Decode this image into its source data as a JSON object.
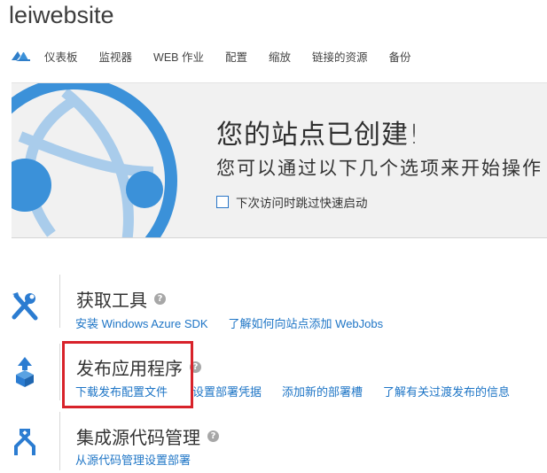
{
  "site": {
    "title": "leiwebsite"
  },
  "nav": {
    "tabs": [
      {
        "label": "仪表板"
      },
      {
        "label": "监视器"
      },
      {
        "label": "WEB 作业"
      },
      {
        "label": "配置"
      },
      {
        "label": "缩放"
      },
      {
        "label": "链接的资源"
      },
      {
        "label": "备份"
      }
    ]
  },
  "hero": {
    "title": "您的站点已创建!",
    "subtitle": "您可以通过以下几个选项来开始操作",
    "skip_label": "下次访问时跳过快速启动"
  },
  "sections": [
    {
      "title": "获取工具",
      "links": [
        "安装 Windows Azure SDK",
        "了解如何向站点添加 WebJobs"
      ]
    },
    {
      "title": "发布应用程序",
      "links": [
        "下载发布配置文件",
        "设置部署凭据",
        "添加新的部署槽",
        "了解有关过渡发布的信息"
      ]
    },
    {
      "title": "集成源代码管理",
      "links": [
        "从源代码管理设置部署"
      ]
    }
  ],
  "icons": {
    "nav_logo": "azure-cloud-icon",
    "hero": "azure-website-globe-icon",
    "tools": "tools-icon",
    "publish": "publish-upload-icon",
    "source_control": "source-control-icon",
    "help": "help-icon"
  },
  "colors": {
    "accent": "#1e75c6",
    "globe": "#3b91d9",
    "highlight": "#d8222a"
  }
}
